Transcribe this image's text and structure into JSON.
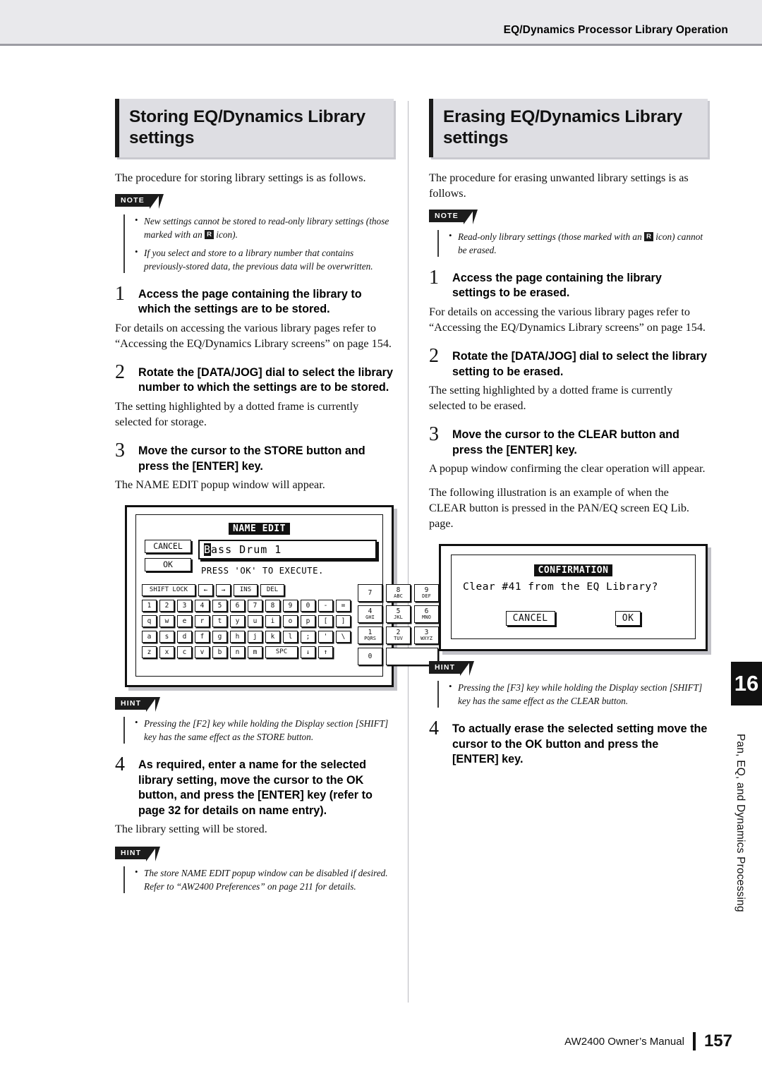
{
  "header": {
    "title": "EQ/Dynamics Processor Library Operation"
  },
  "left": {
    "heading": "Storing EQ/Dynamics Library settings",
    "intro": "The procedure for storing library settings is as follows.",
    "note_label": "NOTE",
    "notes": [
      {
        "pre": "New settings cannot be stored to read-only library settings (those marked with an ",
        "icon": "R",
        "post": " icon)."
      },
      {
        "pre": "If you select and store to a library number that contains previously-stored data, the previous data will be overwritten.",
        "icon": "",
        "post": ""
      }
    ],
    "steps": [
      {
        "num": "1",
        "title": "Access the page containing the library to which the settings are to be stored.",
        "body": "For details on accessing the various library pages refer to “Accessing the EQ/Dynamics Library screens” on page 154."
      },
      {
        "num": "2",
        "title": "Rotate the [DATA/JOG] dial to select the library number to which the settings are to be stored.",
        "body": "The setting highlighted by a dotted frame is currently selected for storage."
      },
      {
        "num": "3",
        "title": "Move the cursor to the STORE button and press the [ENTER] key.",
        "body": "The NAME EDIT popup window will appear."
      },
      {
        "num": "4",
        "title": "As required, enter a name for the selected library setting, move the cursor to the OK button, and press the [ENTER] key (refer to page 32 for details on name entry).",
        "body": "The library setting will be stored."
      }
    ],
    "hint_label": "HINT",
    "hint1": "Pressing the [F2] key while holding the Display section [SHIFT] key has the same effect as the STORE button.",
    "hint2": "The store NAME EDIT popup window can be disabled if desired. Refer to “AW2400 Preferences” on page 211 for details.",
    "lcd": {
      "title": "NAME EDIT",
      "cancel": "CANCEL",
      "ok": "OK",
      "name_cursor": "B",
      "name_rest": "ass Drum 1",
      "execute": "PRESS 'OK' TO EXECUTE.",
      "toprow": [
        "SHIFT LOCK",
        "←",
        "→",
        "INS",
        "DEL"
      ],
      "rows": [
        [
          "1",
          "2",
          "3",
          "4",
          "5",
          "6",
          "7",
          "8",
          "9",
          "0",
          "-",
          "="
        ],
        [
          "q",
          "w",
          "e",
          "r",
          "t",
          "y",
          "u",
          "i",
          "o",
          "p",
          "[",
          "]"
        ],
        [
          "a",
          "s",
          "d",
          "f",
          "g",
          "h",
          "j",
          "k",
          "l",
          ";",
          "'",
          "\\"
        ],
        [
          "z",
          "x",
          "c",
          "v",
          "b",
          "n",
          "m",
          "SPC",
          "↓",
          "↑"
        ]
      ],
      "numpad": [
        [
          {
            "big": "7",
            "sub": ""
          },
          {
            "big": "8",
            "sub": "ABC"
          },
          {
            "big": "9",
            "sub": "DEF"
          }
        ],
        [
          {
            "big": "4",
            "sub": "GHI"
          },
          {
            "big": "5",
            "sub": "JKL"
          },
          {
            "big": "6",
            "sub": "MNO"
          }
        ],
        [
          {
            "big": "1",
            "sub": "PQRS"
          },
          {
            "big": "2",
            "sub": "TUV"
          },
          {
            "big": "3",
            "sub": "WXYZ"
          }
        ],
        [
          {
            "big": "0",
            "sub": ""
          },
          {
            "big": "",
            "sub": ""
          }
        ]
      ]
    }
  },
  "right": {
    "heading": "Erasing EQ/Dynamics Library settings",
    "intro": "The procedure for erasing unwanted library settings is as follows.",
    "note_label": "NOTE",
    "notes": [
      {
        "pre": "Read-only library settings (those marked with an ",
        "icon": "R",
        "post": " icon) cannot be erased."
      }
    ],
    "steps": [
      {
        "num": "1",
        "title": "Access the page containing the library settings to be erased.",
        "body": "For details on accessing the various library pages refer to “Accessing the EQ/Dynamics Library screens” on page 154."
      },
      {
        "num": "2",
        "title": "Rotate the [DATA/JOG] dial to select the library setting to be erased.",
        "body": "The setting highlighted by a dotted frame is currently selected to be erased."
      },
      {
        "num": "3",
        "title": "Move the cursor to the CLEAR button and press the [ENTER] key.",
        "body": "A popup window confirming the clear operation will appear.",
        "body2": "The following illustration is an example of when the CLEAR button is pressed in the PAN/EQ screen EQ Lib. page."
      },
      {
        "num": "4",
        "title": "To actually erase the selected setting move the cursor to the OK button and press the [ENTER] key.",
        "body": ""
      }
    ],
    "hint_label": "HINT",
    "hint1": "Pressing the [F3] key while holding the Display section [SHIFT] key has the same effect as the CLEAR button.",
    "lcd": {
      "title": "CONFIRMATION",
      "message": "Clear #41 from the EQ Library?",
      "cancel": "CANCEL",
      "ok": "OK"
    }
  },
  "chapter": {
    "number": "16",
    "name": "Pan, EQ, and Dynamics Processing"
  },
  "footer": {
    "manual": "AW2400  Owner’s Manual",
    "page": "157"
  }
}
